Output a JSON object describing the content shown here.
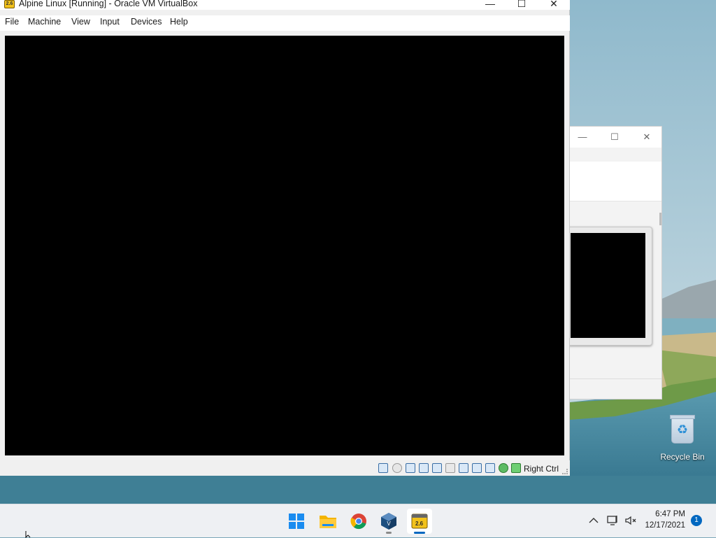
{
  "vm_window": {
    "title": "Alpine Linux [Running] - Oracle VM VirtualBox",
    "app_icon_text": "2.6",
    "controls": {
      "minimize": "—",
      "maximize": "☐",
      "close": "✕"
    },
    "menu": [
      {
        "label": "File"
      },
      {
        "label": "Machine"
      },
      {
        "label": "View"
      },
      {
        "label": "Input"
      },
      {
        "label": "Devices"
      },
      {
        "label": "Help"
      }
    ],
    "status": {
      "host_key": "Right Ctrl",
      "icons": [
        "hard-disk-icon",
        "optical-drive-icon",
        "audio-icon",
        "network-icon",
        "usb-icon",
        "shared-folders-icon",
        "display-icon",
        "recording-icon",
        "video-capture-icon",
        "cpu-icon",
        "mouse-integration-icon",
        "host-key-icon"
      ]
    }
  },
  "background_window": {
    "controls": {
      "minimize": "—",
      "maximize": "☐",
      "close": "✕"
    }
  },
  "desktop": {
    "icons": [
      {
        "label": "Recycle Bin",
        "icon": "recycle-bin-icon"
      }
    ]
  },
  "taskbar": {
    "apps": [
      {
        "name": "start-button",
        "icon": "windows-logo-icon"
      },
      {
        "name": "file-explorer",
        "icon": "folder-icon"
      },
      {
        "name": "chrome",
        "icon": "chrome-icon"
      },
      {
        "name": "virtualbox-manager",
        "icon": "virtualbox-icon"
      },
      {
        "name": "virtualbox-vm",
        "icon": "alpine-vm-icon",
        "icon_text": "2.6"
      }
    ],
    "tray": {
      "time": "6:47 PM",
      "date": "12/17/2021",
      "notification_count": "1"
    }
  },
  "colors": {
    "accent": "#0067c0",
    "vm_screen": "#000000"
  }
}
